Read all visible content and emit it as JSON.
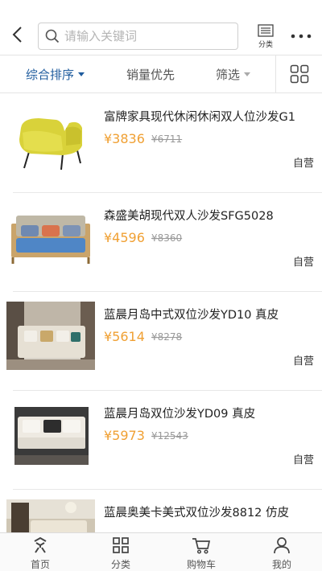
{
  "header": {
    "search_placeholder": "请输入关键词",
    "category_label": "分类"
  },
  "sortbar": {
    "default_label": "综合排序",
    "sales_label": "销量优先",
    "filter_label": "筛选"
  },
  "colors": {
    "active": "#1f5c9e",
    "price": "#f0a033"
  },
  "products": [
    {
      "title": "富牌家具现代休闲休闲双人位沙发G1",
      "price": "¥3836",
      "original_price": "¥6711",
      "tag": "自营"
    },
    {
      "title": "森盛美胡现代双人沙发SFG5028",
      "price": "¥4596",
      "original_price": "¥8360",
      "tag": "自营"
    },
    {
      "title": "蓝晨月岛中式双位沙发YD10 真皮",
      "price": "¥5614",
      "original_price": "¥8278",
      "tag": "自营"
    },
    {
      "title": "蓝晨月岛双位沙发YD09 真皮",
      "price": "¥5973",
      "original_price": "¥12543",
      "tag": "自营"
    },
    {
      "title": "蓝晨奥美卡美式双位沙发8812 仿皮",
      "price": "",
      "original_price": "",
      "tag": ""
    }
  ],
  "bottom_nav": [
    {
      "label": "首页",
      "icon": "home-icon"
    },
    {
      "label": "分类",
      "icon": "category-grid-icon"
    },
    {
      "label": "购物车",
      "icon": "cart-icon"
    },
    {
      "label": "我的",
      "icon": "user-icon"
    }
  ]
}
